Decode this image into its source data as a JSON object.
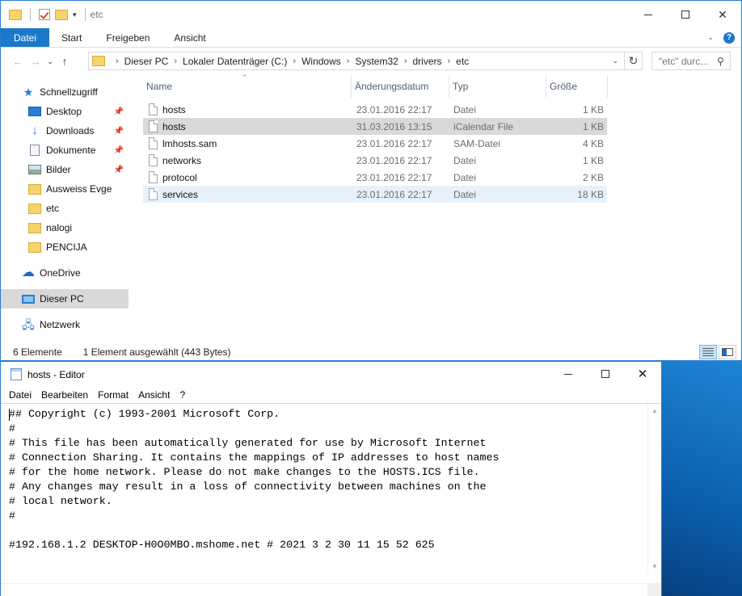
{
  "explorer": {
    "title": "etc",
    "ribbon_tabs": [
      "Datei",
      "Start",
      "Freigeben",
      "Ansicht"
    ],
    "address_path": [
      "Dieser PC",
      "Lokaler Datenträger (C:)",
      "Windows",
      "System32",
      "drivers",
      "etc"
    ],
    "search_placeholder": "\"etc\" durc...",
    "nav_items": [
      {
        "label": "Schnellzugriff",
        "icon": "star-icon"
      },
      {
        "label": "Desktop",
        "icon": "desktop-icon",
        "pinned": true
      },
      {
        "label": "Downloads",
        "icon": "download-icon",
        "pinned": true
      },
      {
        "label": "Dokumente",
        "icon": "documents-icon",
        "pinned": true
      },
      {
        "label": "Bilder",
        "icon": "pictures-icon",
        "pinned": true
      },
      {
        "label": "Ausweiss Evge",
        "icon": "folder-icon"
      },
      {
        "label": "etc",
        "icon": "folder-icon"
      },
      {
        "label": "nalogi",
        "icon": "folder-icon"
      },
      {
        "label": "PENCIJA",
        "icon": "folder-icon"
      },
      {
        "label": "OneDrive",
        "icon": "cloud-icon"
      },
      {
        "label": "Dieser PC",
        "icon": "pc-icon",
        "selected": true
      },
      {
        "label": "Netzwerk",
        "icon": "network-icon"
      }
    ],
    "columns": [
      "Name",
      "Änderungsdatum",
      "Typ",
      "Größe"
    ],
    "files": [
      {
        "name": "hosts",
        "date": "23.01.2016 22:17",
        "type": "Datei",
        "size": "1 KB"
      },
      {
        "name": "hosts",
        "date": "31.03.2016 13:15",
        "type": "iCalendar File",
        "size": "1 KB"
      },
      {
        "name": "lmhosts.sam",
        "date": "23.01.2016 22:17",
        "type": "SAM-Datei",
        "size": "4 KB"
      },
      {
        "name": "networks",
        "date": "23.01.2016 22:17",
        "type": "Datei",
        "size": "1 KB"
      },
      {
        "name": "protocol",
        "date": "23.01.2016 22:17",
        "type": "Datei",
        "size": "2 KB"
      },
      {
        "name": "services",
        "date": "23.01.2016 22:17",
        "type": "Datei",
        "size": "18 KB"
      }
    ],
    "status": {
      "count": "6 Elemente",
      "selection": "1 Element ausgewählt (443 Bytes)"
    }
  },
  "notepad": {
    "title": "hosts - Editor",
    "menu": [
      "Datei",
      "Bearbeiten",
      "Format",
      "Ansicht",
      "?"
    ],
    "content": "## Copyright (c) 1993-2001 Microsoft Corp.\n#\n# This file has been automatically generated for use by Microsoft Internet\n# Connection Sharing. It contains the mappings of IP addresses to host names\n# for the home network. Please do not make changes to the HOSTS.ICS file.\n# Any changes may result in a loss of connectivity between machines on the\n# local network.\n#\n\n#192.168.1.2 DESKTOP-H0O0MBO.mshome.net # 2021 3 2 30 11 15 52 625"
  },
  "colors": {
    "accent": "#1979ca",
    "selection_gray": "#d9d9d9",
    "selection_blue": "#e5f1fb"
  }
}
